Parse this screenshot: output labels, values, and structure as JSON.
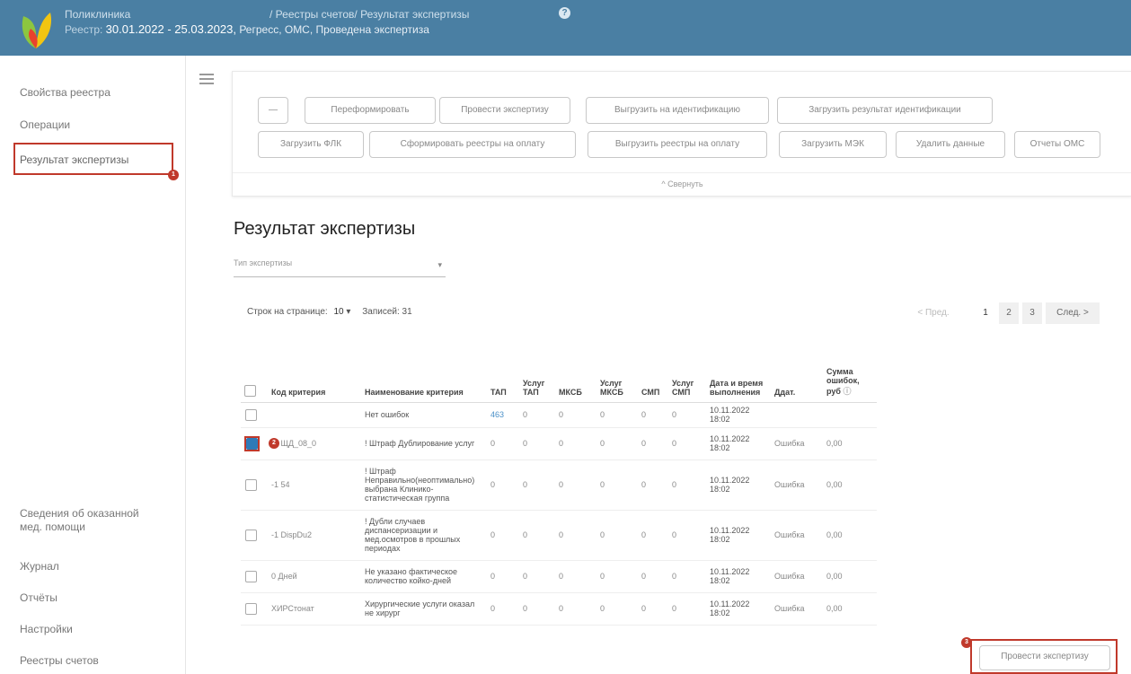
{
  "header": {
    "org": "Поликлиника",
    "breadcrumb": "/ Реестры счетов/ Результат экспертизы",
    "registry_prefix": "Реестр:",
    "registry_dates": "30.01.2022 - 25.03.2023,",
    "registry_rest": "Регресс, ОМС, Проведена экспертиза",
    "help_icon": "?"
  },
  "sidebar": {
    "items": [
      {
        "label": "Свойства реестра"
      },
      {
        "label": "Операции"
      },
      {
        "label": "Результат экспертизы"
      },
      {
        "label": "Сведения об оказанной мед. помощи"
      },
      {
        "label": "Журнал"
      },
      {
        "label": "Отчёты"
      },
      {
        "label": "Настройки"
      },
      {
        "label": "Реестры счетов"
      }
    ],
    "badge_1": "1"
  },
  "toolbar": {
    "row1": [
      "—",
      "Переформировать",
      "Провести экспертизу",
      "Выгрузить на идентификацию",
      "Загрузить результат идентификации"
    ],
    "row2": [
      "Загрузить ФЛК",
      "Сформировать реестры на оплату",
      "Выгрузить реестры на оплату",
      "Загрузить МЭК",
      "Удалить данные",
      "Отчеты ОМС"
    ],
    "collapse_label": "^ Свернуть"
  },
  "main": {
    "title": "Результат экспертизы",
    "filter_placeholder": "Тип экспертизы",
    "rows_per_page_label": "Строк на странице:",
    "rows_per_page_value": "10",
    "records_label": "Записей:",
    "records_value": "31",
    "pager": {
      "prev": "< Пред.",
      "pages": [
        "1",
        "2",
        "3"
      ],
      "next": "След. >"
    }
  },
  "table": {
    "headers": [
      "Код критерия",
      "Наименование критерия",
      "ТАП",
      "Услуг ТАП",
      "МКСБ",
      "Услуг МКСБ",
      "СМП",
      "Услуг СМП",
      "Дата и время выполнения",
      "Ддат.",
      "Сумма ошибок, руб"
    ],
    "rows": [
      {
        "code": "",
        "name": "Нет ошибок",
        "tap": "463",
        "utap": "0",
        "mksb": "0",
        "umksb": "0",
        "smp": "0",
        "usmp": "0",
        "date": "10.11.2022 18:02",
        "type": "",
        "sum": "",
        "checked": false
      },
      {
        "code": "-1 ЩД_08_0",
        "name": "! Штраф Дублирование услуг",
        "tap": "0",
        "utap": "0",
        "mksb": "0",
        "umksb": "0",
        "smp": "0",
        "usmp": "0",
        "date": "10.11.2022 18:02",
        "type": "Ошибка",
        "sum": "0,00",
        "checked": true
      },
      {
        "code": "-1 54",
        "name": "! Штраф Неправильно(неоптимально) выбрана Клинико-статистическая группа",
        "tap": "0",
        "utap": "0",
        "mksb": "0",
        "umksb": "0",
        "smp": "0",
        "usmp": "0",
        "date": "10.11.2022 18:02",
        "type": "Ошибка",
        "sum": "0,00",
        "checked": false
      },
      {
        "code": "-1 DispDu2",
        "name": "! Дубли случаев диспансеризации и мед.осмотров в прошлых периодах",
        "tap": "0",
        "utap": "0",
        "mksb": "0",
        "umksb": "0",
        "smp": "0",
        "usmp": "0",
        "date": "10.11.2022 18:02",
        "type": "Ошибка",
        "sum": "0,00",
        "checked": false
      },
      {
        "code": "0 Дней",
        "name": "Не указано фактическое количество койко-дней",
        "tap": "0",
        "utap": "0",
        "mksb": "0",
        "umksb": "0",
        "smp": "0",
        "usmp": "0",
        "date": "10.11.2022 18:02",
        "type": "Ошибка",
        "sum": "0,00",
        "checked": false
      },
      {
        "code": "ХИРСтонат",
        "name": "Хирургические услуги оказал не хирург",
        "tap": "0",
        "utap": "0",
        "mksb": "0",
        "umksb": "0",
        "smp": "0",
        "usmp": "0",
        "date": "10.11.2022 18:02",
        "type": "Ошибка",
        "sum": "0,00",
        "checked": false
      }
    ]
  },
  "bottom": {
    "button": "Провести экспертизу",
    "badge_2": "2",
    "badge_3": "3"
  }
}
